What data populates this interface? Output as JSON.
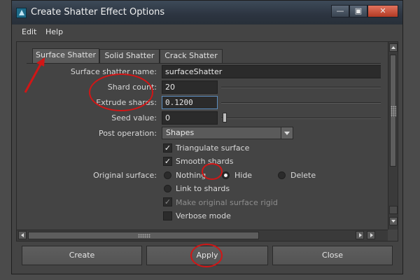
{
  "window": {
    "title": "Create Shatter Effect Options",
    "controls": {
      "minimize": "—",
      "maximize": "▣",
      "close": "✕"
    }
  },
  "menu": {
    "items": [
      "Edit",
      "Help"
    ]
  },
  "tabs": [
    {
      "label": "Surface Shatter",
      "active": true
    },
    {
      "label": "Solid Shatter",
      "active": false
    },
    {
      "label": "Crack Shatter",
      "active": false
    }
  ],
  "form": {
    "name": {
      "label": "Surface shatter name:",
      "value": "surfaceShatter"
    },
    "shard_count": {
      "label": "Shard count:",
      "value": "20"
    },
    "extrude_shards": {
      "label": "Extrude shards:",
      "value": "0.1200"
    },
    "seed_value": {
      "label": "Seed value:",
      "value": "0"
    },
    "post_operation": {
      "label": "Post operation:",
      "value": "Shapes"
    },
    "triangulate_surface": {
      "label": "Triangulate surface",
      "checked": true
    },
    "smooth_shards": {
      "label": "Smooth shards",
      "checked": true
    },
    "original_surface": {
      "label": "Original surface:",
      "options": [
        "Nothing",
        "Hide",
        "Delete",
        "Link to shards"
      ],
      "selected": "Hide"
    },
    "make_rigid": {
      "label": "Make original surface rigid",
      "checked": true,
      "enabled": false
    },
    "verbose_mode": {
      "label": "Verbose mode",
      "checked": false
    }
  },
  "buttons": {
    "create": "Create",
    "apply": "Apply",
    "close": "Close"
  },
  "annotation_color": "#d11616"
}
